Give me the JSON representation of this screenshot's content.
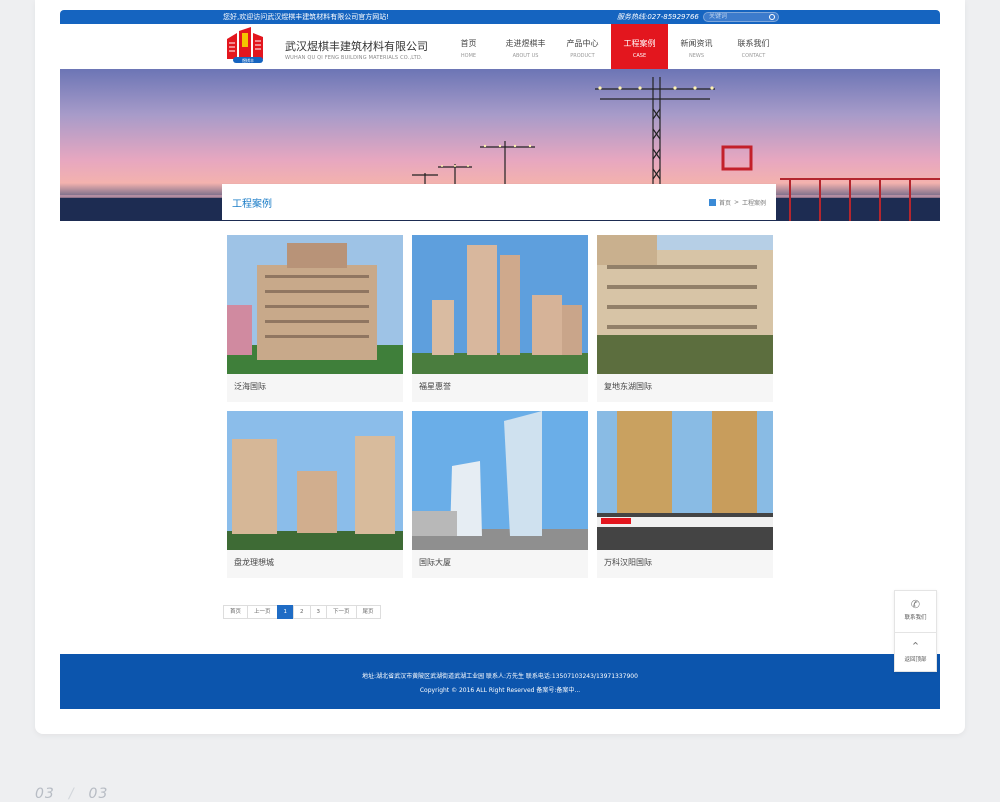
{
  "topbar": {
    "welcome": "您好,欢迎访问武汉煜棋丰建筑材料有限公司官方网站!",
    "hotline": "服务热线:027-85929766",
    "search_placeholder": "关键词"
  },
  "header": {
    "company_name": "武汉煜棋丰建筑材料有限公司",
    "company_name_en": "WUHAN QU QI FENG BUILDING MATERIALS CO.,LTD.",
    "logo_text": "煜棋丰"
  },
  "nav": [
    {
      "cn": "首页",
      "en": "HOME"
    },
    {
      "cn": "走进煜棋丰",
      "en": "ABOUT US"
    },
    {
      "cn": "产品中心",
      "en": "PRODUCT"
    },
    {
      "cn": "工程案例",
      "en": "CASE"
    },
    {
      "cn": "新闻资讯",
      "en": "NEWS"
    },
    {
      "cn": "联系我们",
      "en": "CONTACT"
    }
  ],
  "section": {
    "title": "工程案例",
    "breadcrumb_home": "首页",
    "breadcrumb_sep": ">",
    "breadcrumb_current": "工程案例"
  },
  "cases": [
    {
      "name": "泛海国际"
    },
    {
      "name": "福星惠誉"
    },
    {
      "name": "复地东湖国际"
    },
    {
      "name": "盘龙理想城"
    },
    {
      "name": "国际大厦"
    },
    {
      "name": "万科汉阳国际"
    }
  ],
  "pagination": {
    "first": "首页",
    "prev": "上一页",
    "pages": [
      "1",
      "2",
      "3"
    ],
    "next": "下一页",
    "last": "尾页",
    "current": "1"
  },
  "footer": {
    "line1": "地址:湖北省武汉市黄陂区武湖街道武湖工业园 联系人:方先生 联系电话:13507103243/13971337900",
    "line2": "Copyright © 2016 ALL Right Reserved 备案号:备案中..."
  },
  "float": {
    "contact": "联系我们",
    "top": "返回顶部"
  },
  "page_indicator": {
    "current": "03",
    "total": "03"
  },
  "colors": {
    "brand_blue": "#1564c0",
    "nav_active": "#e3161e",
    "footer_blue": "#0c55ad"
  }
}
